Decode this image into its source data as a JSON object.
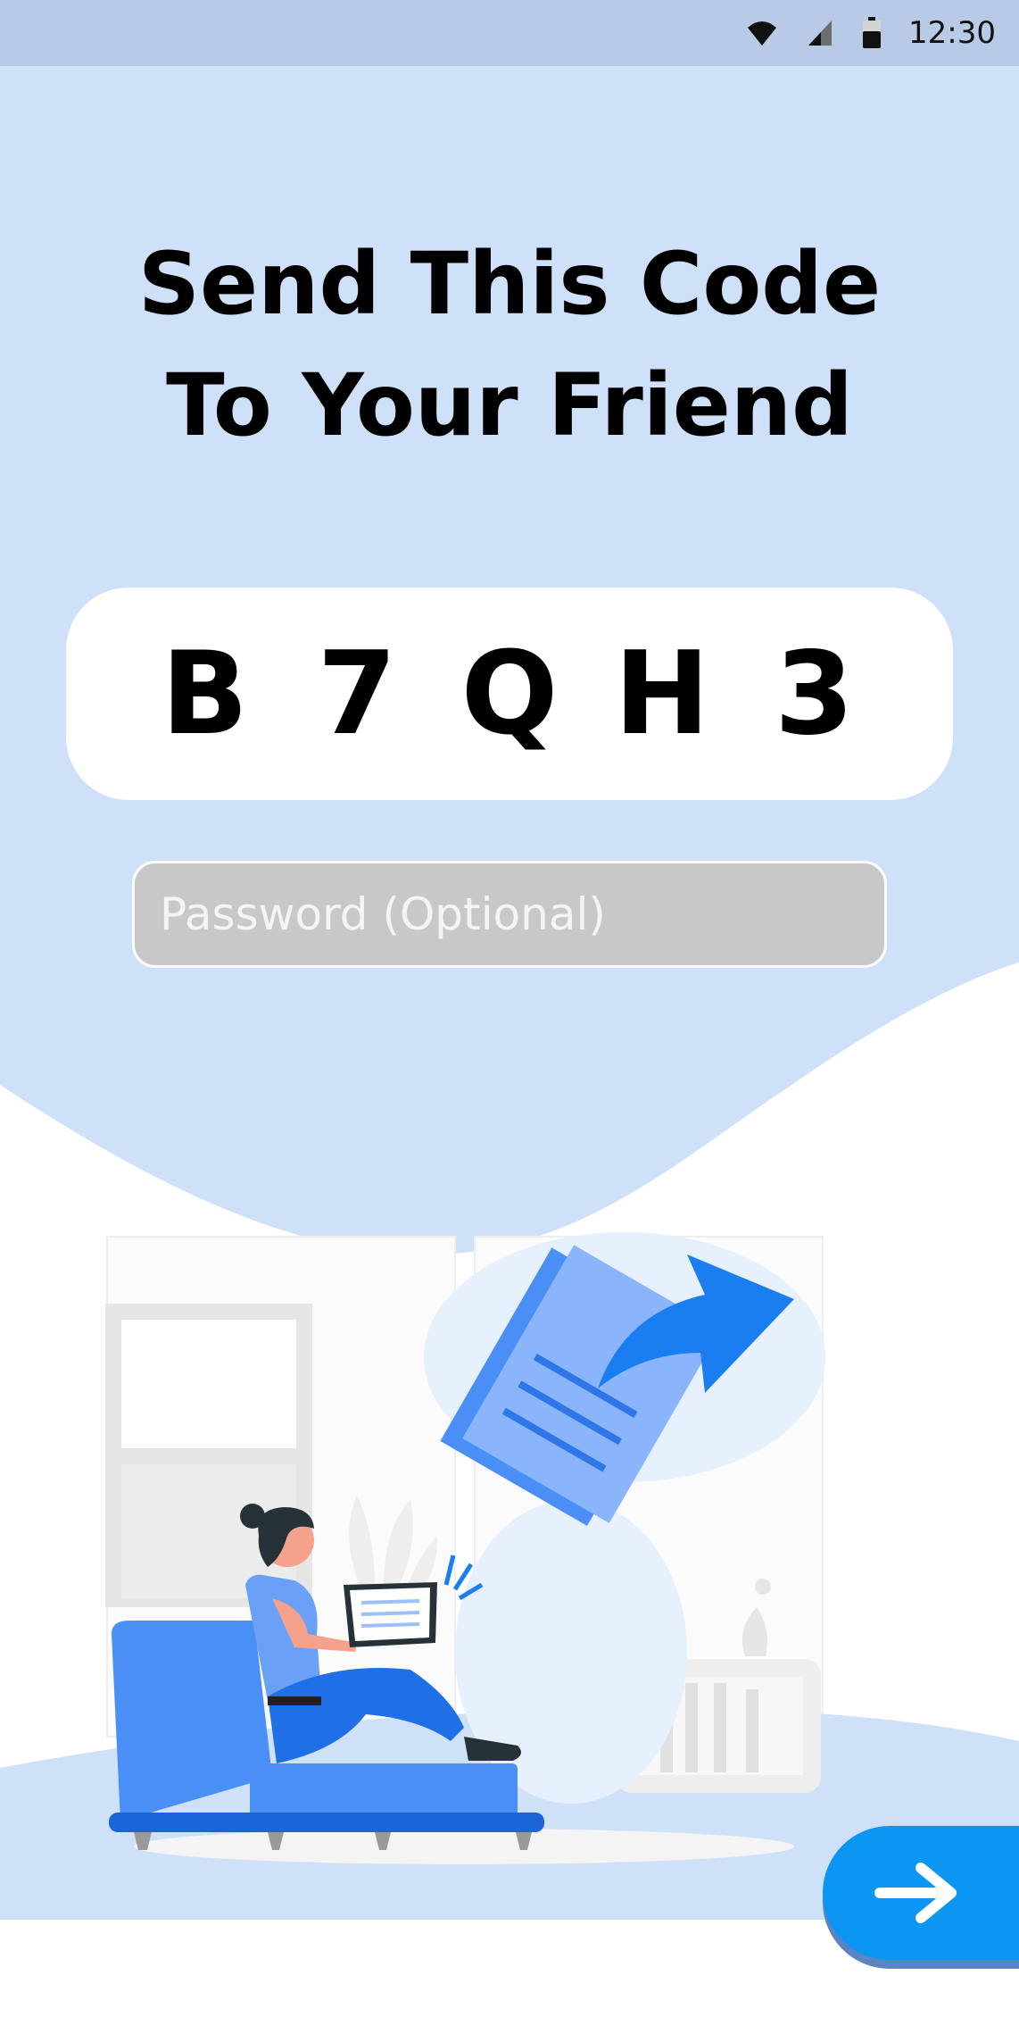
{
  "status_bar": {
    "time": "12:30",
    "icons": [
      "wifi-icon",
      "cellular-signal-icon",
      "battery-icon"
    ]
  },
  "heading": {
    "line1": "Send This Code",
    "line2": "To Your Friend"
  },
  "code": {
    "chars": [
      "B",
      "7",
      "Q",
      "H",
      "3"
    ]
  },
  "password": {
    "placeholder": "Password (Optional)",
    "value": ""
  },
  "next_button": {
    "icon": "arrow-right-icon"
  },
  "colors": {
    "background": "#cfe0f9",
    "status_bar": "#b8cae6",
    "accent": "#0a96f2",
    "illustration_blue": "#4a8ff5"
  }
}
